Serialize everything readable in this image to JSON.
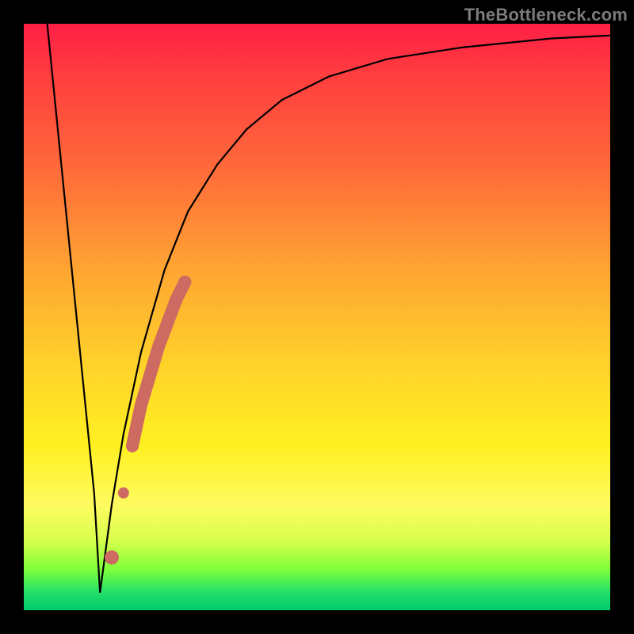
{
  "watermark": "TheBottleneck.com",
  "chart_data": {
    "type": "line",
    "title": "",
    "xlabel": "",
    "ylabel": "",
    "xlim": [
      0,
      100
    ],
    "ylim": [
      0,
      100
    ],
    "grid": false,
    "legend": false,
    "annotations": [],
    "series": [
      {
        "name": "curve-left",
        "x": [
          4,
          6,
          8,
          10,
          12,
          13
        ],
        "values": [
          100,
          80,
          60,
          40,
          20,
          3
        ]
      },
      {
        "name": "curve-right",
        "x": [
          13,
          15,
          17,
          20,
          24,
          28,
          33,
          38,
          44,
          52,
          62,
          75,
          90,
          100
        ],
        "values": [
          3,
          18,
          30,
          44,
          58,
          68,
          76,
          82,
          87,
          91,
          94,
          96,
          97.5,
          98
        ]
      }
    ],
    "highlight": {
      "name": "highlight-segment",
      "x": [
        15,
        17,
        18.5,
        20,
        21.5,
        23,
        24.5,
        26,
        27.5
      ],
      "values": [
        9,
        20,
        28,
        35,
        40,
        45,
        49,
        53,
        56
      ],
      "color": "#cd6a62"
    }
  },
  "colors": {
    "curve": "#000000",
    "highlight": "#cd6a62",
    "frame": "#000000"
  }
}
